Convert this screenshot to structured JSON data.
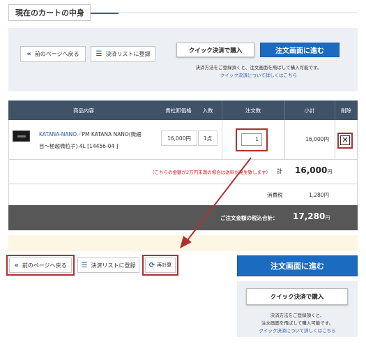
{
  "header": {
    "title": "現在のカートの中身"
  },
  "top_panel": {
    "back_label": "前のページへ戻る",
    "save_list_label": "決済リストに登録",
    "quick_buy_label": "クイック決済で購入",
    "proceed_label": "注文画面に進む",
    "note": "決済方法をご登録頂くと、注文画面を飛ばして購入可能です。",
    "note_link": "クイック決済について詳しくはこちら"
  },
  "table": {
    "headers": {
      "product": "商品内容",
      "price": "貴社卸価格",
      "count": "入数",
      "qty": "注文数",
      "subtotal": "小計",
      "delete": "削除"
    },
    "item": {
      "name_link": "KATANA-NANO",
      "name_rest_line1": "／PM KATANA NANO(微細",
      "name_rest_line2": "目～極超微粒子) 4L [14456-04 ]",
      "price": "16,000円",
      "count": "1点",
      "qty": "1",
      "subtotal": "16,000円",
      "delete_mark": "✕"
    },
    "warning": "（こちらの金額が2万円未満の場合は送料が発生致します）",
    "sum_label": "計",
    "sum_value": "16,000",
    "sum_unit": "円",
    "tax_label": "消費税",
    "tax_value": "1,280円",
    "total_label": "ご注文金額の税込合計：",
    "total_value": "17,280",
    "total_unit": "円"
  },
  "bottom": {
    "back_label": "前のページへ戻る",
    "save_list_label": "決済リストに登録",
    "recalc_label": "再計算",
    "proceed_label": "注文画面に進む",
    "quick_buy_label": "クイック決済で購入",
    "note_line1": "決済方法をご登録頂くと、",
    "note_line2": "注文画面を飛ばして購入可能です。",
    "note_link": "クイック決済について詳しくはこちら"
  },
  "icons": {
    "back": "double-chevron-left-icon",
    "list": "list-icon",
    "recalc": "refresh-icon",
    "arrow": "red-arrow-annotation"
  },
  "colors": {
    "header_bg": "#3f5267",
    "button_blue": "#1b6bc0",
    "link": "#2b5aa8",
    "highlight_red": "#b03030",
    "total_bg": "#575757"
  }
}
